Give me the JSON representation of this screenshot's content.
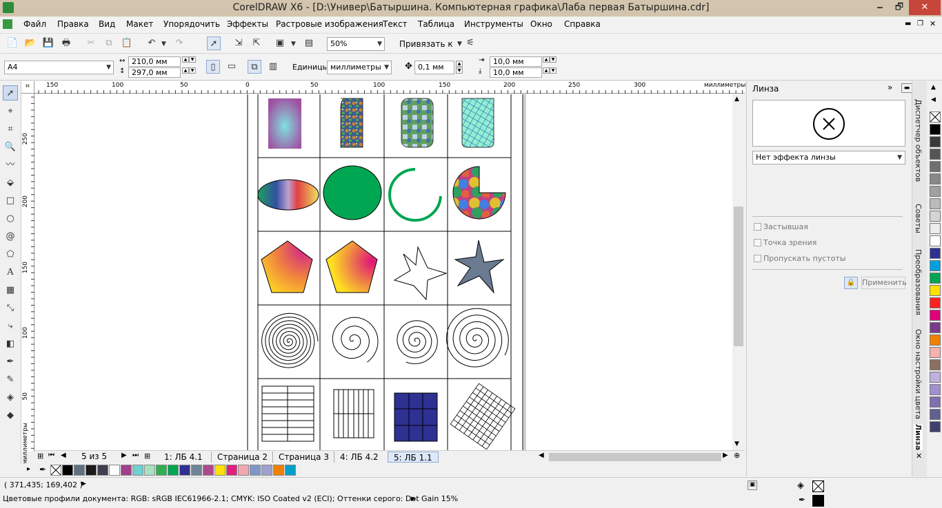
{
  "window": {
    "title": "CorelDRAW X6 - [D:\\Универ\\Батыршина. Компьютерная графика\\Лаба первая Батыршина.cdr]",
    "minimize": "🗕",
    "restore": "🗗",
    "close": "✕"
  },
  "menu": [
    "Файл",
    "Правка",
    "Вид",
    "Макет",
    "Упорядочить",
    "Эффекты",
    "Растровые изображения",
    "Текст",
    "Таблица",
    "Инструменты",
    "Окно",
    "Справка"
  ],
  "toolbar": {
    "zoom": "50%",
    "snap_label": "Привязать к"
  },
  "propbar": {
    "page_size": "A4",
    "width": "210,0 мм",
    "height": "297,0 мм",
    "units_label": "Единицы:",
    "units": "миллиметры",
    "nudge": "0,1 мм",
    "dup_x": "10,0 мм",
    "dup_y": "10,0 мм"
  },
  "ruler": {
    "h_ticks": [
      "150",
      "100",
      "50",
      "0",
      "50",
      "100",
      "150",
      "200",
      "250",
      "300"
    ],
    "h_unit": "миллиметры",
    "v_ticks": [
      "250",
      "200",
      "150",
      "100",
      "50"
    ],
    "v_unit": "миллиметры"
  },
  "pages": {
    "counter": "5 из 5",
    "tabs": [
      "1: ЛБ 4.1",
      "Страница 2",
      "Страница 3",
      "4: ЛБ 4.2",
      "5: ЛБ 1.1"
    ],
    "active": "5: ЛБ 1.1"
  },
  "palette": [
    "#000000",
    "#607080",
    "#1a1a1a",
    "#3f3f4f",
    "#ffffff",
    "#a0408c",
    "#70d0d0",
    "#a8e0c0",
    "#2fb050",
    "#00a651",
    "#2e3192",
    "#70849a",
    "#b0488c",
    "#ffe000",
    "#e0207c",
    "#f0a8b0",
    "#8096c8",
    "#a0a0d0",
    "#f08000",
    "#00a0c8"
  ],
  "docker": {
    "title": "Линза",
    "effect": "Нет эффекта линзы",
    "frozen": "Застывшая",
    "viewpoint": "Точка зрения",
    "remove_face": "Пропускать пустоты",
    "apply": "Применить"
  },
  "docker_tabs": [
    "Диспетчер объектов",
    "Советы",
    "Преобразования",
    "Окно настройки цвета",
    "Линза"
  ],
  "right_palette": [
    "#000000",
    "#3a3a3a",
    "#555555",
    "#707070",
    "#888888",
    "#a0a0a0",
    "#bbbbbb",
    "#d5d5d5",
    "#ececec",
    "#ffffff",
    "#2e3192",
    "#00a0e0",
    "#00a651",
    "#ffe000",
    "#ff2020",
    "#e0007a",
    "#7a3a8a",
    "#f08000",
    "#f8b0b0",
    "#8a7060",
    "#c0b0e0",
    "#a090d0",
    "#8070b0",
    "#606090",
    "#404070"
  ],
  "status": {
    "coords": "( 371,435; 169,402 )",
    "profiles": "Цветовые профили документа: RGB: sRGB IEC61966-2.1; CMYK: ISO Coated v2 (ECI); Оттенки серого: Dot Gain 15%"
  },
  "colors": {
    "accent": "#3a7bd5",
    "window_close": "#c7463a",
    "titlebar": "#d3c4ad"
  }
}
